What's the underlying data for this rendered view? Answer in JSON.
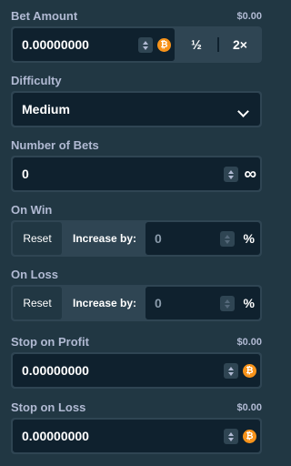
{
  "bet_amount": {
    "label": "Bet Amount",
    "usd": "$0.00",
    "value": "0.00000000",
    "currency_icon": "bitcoin-icon",
    "half_label": "½",
    "double_label": "2×"
  },
  "difficulty": {
    "label": "Difficulty",
    "selected": "Medium"
  },
  "number_of_bets": {
    "label": "Number of Bets",
    "value": "0",
    "infinity_symbol": "∞"
  },
  "on_win": {
    "label": "On Win",
    "reset_label": "Reset",
    "increase_label": "Increase by:",
    "value": "0",
    "percent_symbol": "%"
  },
  "on_loss": {
    "label": "On Loss",
    "reset_label": "Reset",
    "increase_label": "Increase by:",
    "value": "0",
    "percent_symbol": "%"
  },
  "stop_on_profit": {
    "label": "Stop on Profit",
    "usd": "$0.00",
    "value": "0.00000000"
  },
  "stop_on_loss": {
    "label": "Stop on Loss",
    "usd": "$0.00",
    "value": "0.00000000"
  },
  "colors": {
    "background": "#213743",
    "input_bg": "#0f212e",
    "border": "#2f4553",
    "label": "#b1bad3",
    "bitcoin": "#f7931a"
  }
}
